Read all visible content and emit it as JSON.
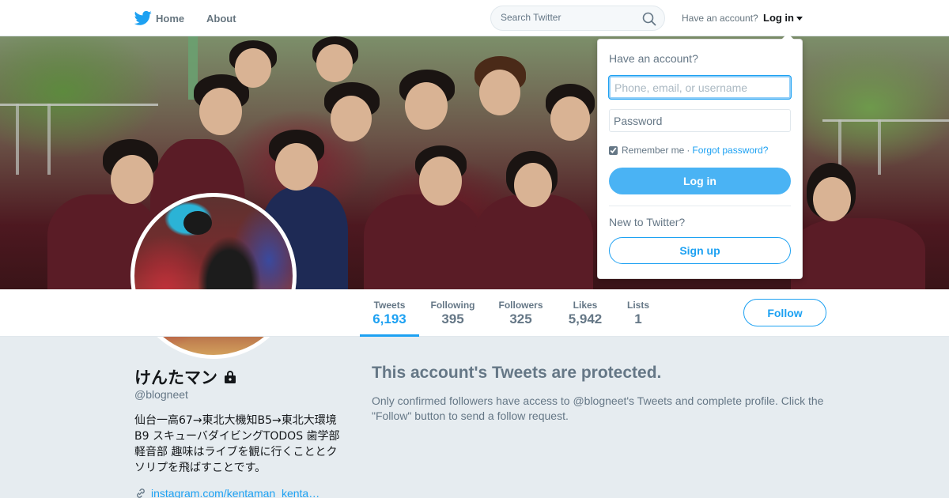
{
  "nav": {
    "home_label": "Home",
    "about_label": "About",
    "search_placeholder": "Search Twitter",
    "have_account_text": "Have an account?",
    "login_label": "Log in",
    "brand_icon": "twitter-bird-icon"
  },
  "profile": {
    "name": "けんたマン",
    "handle": "@blogneet",
    "bio": "仙台一高67→東北大機知B5→東北大環境B9 スキューバダイビングTODOS 歯学部軽音部 趣味はライブを観に行くこととクソリプを飛ばすことです。",
    "url_text": "instagram.com/kentaman_kenta…",
    "protected_icon": "lock-icon",
    "url_icon": "link-icon"
  },
  "stats": [
    {
      "label": "Tweets",
      "value": "6,193",
      "active": true
    },
    {
      "label": "Following",
      "value": "395",
      "active": false
    },
    {
      "label": "Followers",
      "value": "325",
      "active": false
    },
    {
      "label": "Likes",
      "value": "5,942",
      "active": false
    },
    {
      "label": "Lists",
      "value": "1",
      "active": false
    }
  ],
  "follow_label": "Follow",
  "protected": {
    "title": "This account's Tweets are protected.",
    "text": "Only confirmed followers have access to @blogneet's Tweets and complete profile. Click the \"Follow\" button to send a follow request."
  },
  "login_dropdown": {
    "heading": "Have an account?",
    "username_placeholder": "Phone, email, or username",
    "password_placeholder": "Password",
    "remember_label": "Remember me",
    "separator": "·",
    "forgot_label": "Forgot password?",
    "login_button": "Log in",
    "new_text": "New to Twitter?",
    "signup_button": "Sign up",
    "remember_checked": true
  },
  "colors": {
    "accent": "#1da1f2",
    "background": "#e6ecf0",
    "text_muted": "#657786"
  }
}
